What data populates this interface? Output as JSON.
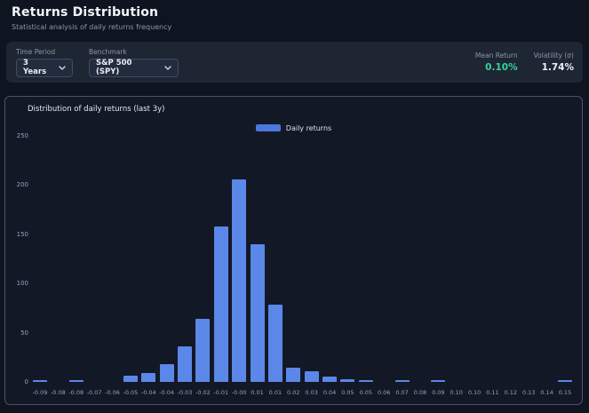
{
  "page": {
    "title": "Returns Distribution",
    "subtitle": "Statistical analysis of daily returns frequency"
  },
  "toolbar": {
    "time_period": {
      "label": "Time Period",
      "value": "3 Years"
    },
    "benchmark": {
      "label": "Benchmark",
      "value": "S&P 500 (SPY)"
    },
    "stats": [
      {
        "label": "Mean Return",
        "value": "0.10%",
        "color": "#35d49b"
      },
      {
        "label": "Volatility (σ)",
        "value": "1.74%",
        "color": "#eef1f7"
      }
    ]
  },
  "chart_data": {
    "type": "bar",
    "title": "Distribution of daily returns (last 3y)",
    "series_color": "#5b87e8",
    "legend": [
      {
        "label": "Daily returns",
        "color": "#4c78dd"
      }
    ],
    "legend_position": "top-center",
    "grid": false,
    "xlabel": "",
    "ylabel": "",
    "ylim": [
      0,
      250
    ],
    "yticks": [
      0,
      50,
      100,
      150,
      200,
      250
    ],
    "categories": [
      "-0.09",
      "-0.08",
      "-0.08",
      "-0.07",
      "-0.06",
      "-0.05",
      "-0.04",
      "-0.04",
      "-0.03",
      "-0.02",
      "-0.01",
      "-0.00",
      "0.01",
      "0.01",
      "0.02",
      "0.03",
      "0.04",
      "0.05",
      "0.05",
      "0.06",
      "0.07",
      "0.08",
      "0.09",
      "0.10",
      "0.10",
      "0.11",
      "0.12",
      "0.13",
      "0.14",
      "0.15"
    ],
    "values": [
      1,
      0,
      1,
      0,
      0,
      6,
      9,
      18,
      36,
      64,
      158,
      205,
      140,
      78,
      14,
      11,
      5,
      3,
      2,
      0,
      2,
      0,
      2,
      0,
      0,
      0,
      0,
      0,
      0,
      2
    ]
  },
  "colors": {
    "page_bg": "#0f1421",
    "toolbar_bg": "#1e2533",
    "panel_bg": "#131827",
    "panel_border": "#4a5266",
    "bar": "#5b87e8",
    "positive": "#35d49b"
  }
}
